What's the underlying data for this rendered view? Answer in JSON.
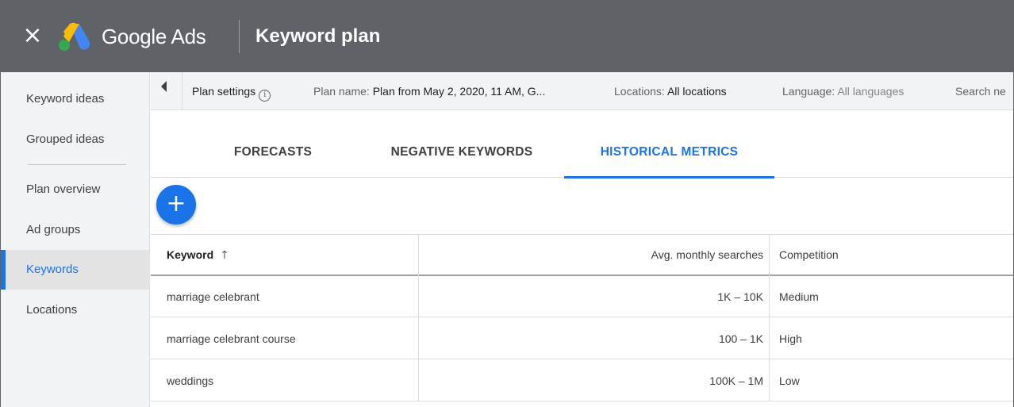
{
  "appbar": {
    "brand": "Google Ads",
    "title": "Keyword plan"
  },
  "colors": {
    "appbar_bg": "#5f6368",
    "accent": "#1a73e8",
    "logo_yellow": "#fbbc04",
    "logo_blue": "#4285f4",
    "logo_green": "#34a853"
  },
  "sidebar": {
    "items": [
      {
        "label": "Keyword ideas",
        "active": false
      },
      {
        "label": "Grouped ideas",
        "active": false
      },
      {
        "label": "Plan overview",
        "active": false
      },
      {
        "label": "Ad groups",
        "active": false
      },
      {
        "label": "Keywords",
        "active": true
      },
      {
        "label": "Locations",
        "active": false
      }
    ]
  },
  "settings": {
    "plan_settings_label": "Plan settings",
    "plan_name_label": "Plan name:",
    "plan_name_value": "Plan from May 2, 2020, 11 AM, G...",
    "locations_label": "Locations:",
    "locations_value": "All locations",
    "language_label": "Language:",
    "language_value": "All languages",
    "search_label": "Search ne"
  },
  "tabs": [
    {
      "label": "FORECASTS",
      "active": false
    },
    {
      "label": "NEGATIVE KEYWORDS",
      "active": false
    },
    {
      "label": "HISTORICAL METRICS",
      "active": true
    }
  ],
  "fab": {
    "icon": "plus-icon",
    "glyph": "+"
  },
  "table": {
    "headers": {
      "keyword": "Keyword",
      "avg": "Avg. monthly searches",
      "competition": "Competition"
    },
    "sort": "ascending",
    "rows": [
      {
        "keyword": "marriage celebrant",
        "avg": "1K – 10K",
        "competition": "Medium"
      },
      {
        "keyword": "marriage celebrant course",
        "avg": "100 – 1K",
        "competition": "High"
      },
      {
        "keyword": "weddings",
        "avg": "100K – 1M",
        "competition": "Low"
      }
    ]
  }
}
